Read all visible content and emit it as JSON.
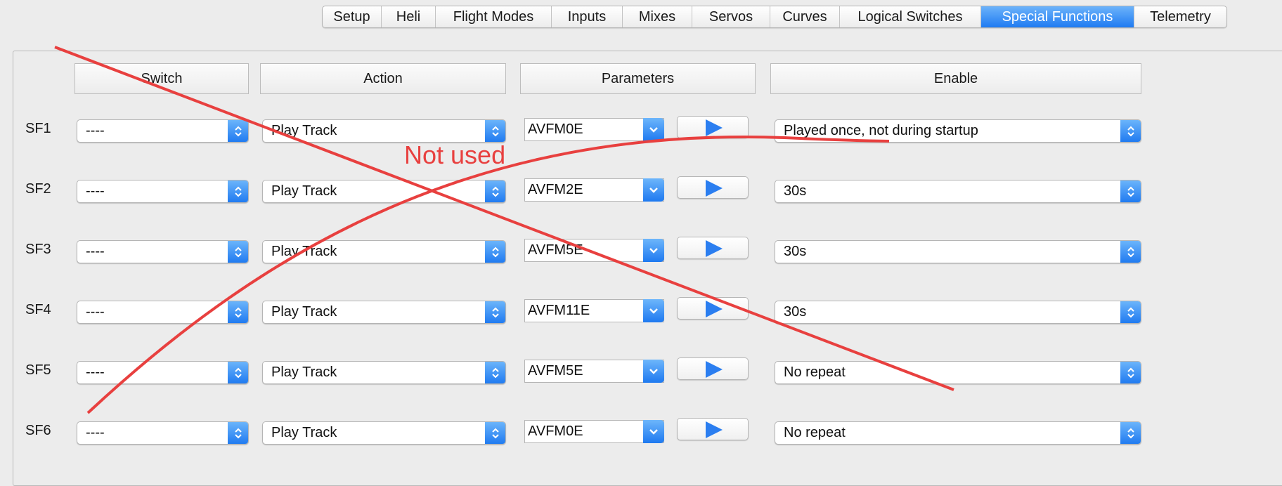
{
  "tabs": [
    {
      "label": "Setup"
    },
    {
      "label": "Heli"
    },
    {
      "label": "Flight Modes"
    },
    {
      "label": "Inputs"
    },
    {
      "label": "Mixes"
    },
    {
      "label": "Servos"
    },
    {
      "label": "Curves"
    },
    {
      "label": "Logical Switches"
    },
    {
      "label": "Special Functions"
    },
    {
      "label": "Telemetry"
    }
  ],
  "active_tab": "Special Functions",
  "columns": {
    "switch": "Switch",
    "action": "Action",
    "parameters": "Parameters",
    "enable": "Enable"
  },
  "rows": [
    {
      "label": "SF1",
      "switch": "----",
      "action": "Play Track",
      "param": "AVFM0E",
      "enable": "Played once, not during startup"
    },
    {
      "label": "SF2",
      "switch": "----",
      "action": "Play Track",
      "param": "AVFM2E",
      "enable": "30s"
    },
    {
      "label": "SF3",
      "switch": "----",
      "action": "Play Track",
      "param": "AVFM5E",
      "enable": "30s"
    },
    {
      "label": "SF4",
      "switch": "----",
      "action": "Play Track",
      "param": "AVFM11E",
      "enable": "30s"
    },
    {
      "label": "SF5",
      "switch": "----",
      "action": "Play Track",
      "param": "AVFM5E",
      "enable": "No repeat"
    },
    {
      "label": "SF6",
      "switch": "----",
      "action": "Play Track",
      "param": "AVFM0E",
      "enable": "No repeat"
    }
  ],
  "annotation": {
    "text": "Not used",
    "color": "#e8403f"
  },
  "colors": {
    "accent": "#1f7bf2",
    "background": "#ececec"
  },
  "icons": {
    "popup_stepper": "up-down-chevron-icon",
    "combo_dropdown": "chevron-down-icon",
    "play": "play-icon"
  }
}
